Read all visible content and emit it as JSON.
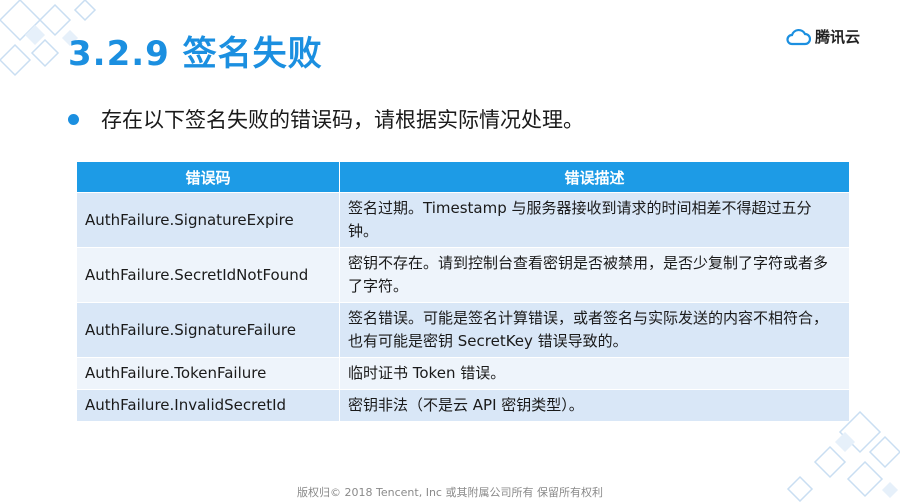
{
  "slide": {
    "title": "3.2.9 签名失败",
    "logo_text": "腾讯云",
    "bullet": "存在以下签名失败的错误码，请根据实际情况处理。",
    "table": {
      "headers": [
        "错误码",
        "错误描述"
      ],
      "rows": [
        {
          "code": "AuthFailure.SignatureExpire",
          "desc": "签名过期。Timestamp 与服务器接收到请求的时间相差不得超过五分钟。"
        },
        {
          "code": "AuthFailure.SecretIdNotFound",
          "desc": "密钥不存在。请到控制台查看密钥是否被禁用，是否少复制了字符或者多了字符。"
        },
        {
          "code": "AuthFailure.SignatureFailure",
          "desc": "签名错误。可能是签名计算错误，或者签名与实际发送的内容不相符合，也有可能是密钥 SecretKey 错误导致的。"
        },
        {
          "code": "AuthFailure.TokenFailure",
          "desc": "临时证书 Token 错误。"
        },
        {
          "code": "AuthFailure.InvalidSecretId",
          "desc": "密钥非法（不是云 API 密钥类型）。"
        }
      ]
    },
    "footer": "版权归© 2018 Tencent, Inc 或其附属公司所有 保留所有权利"
  },
  "colors": {
    "accent": "#1b8fe0",
    "header_bg": "#1d9be6",
    "row_dark": "#d9e7f7",
    "row_light": "#eef4fb"
  }
}
